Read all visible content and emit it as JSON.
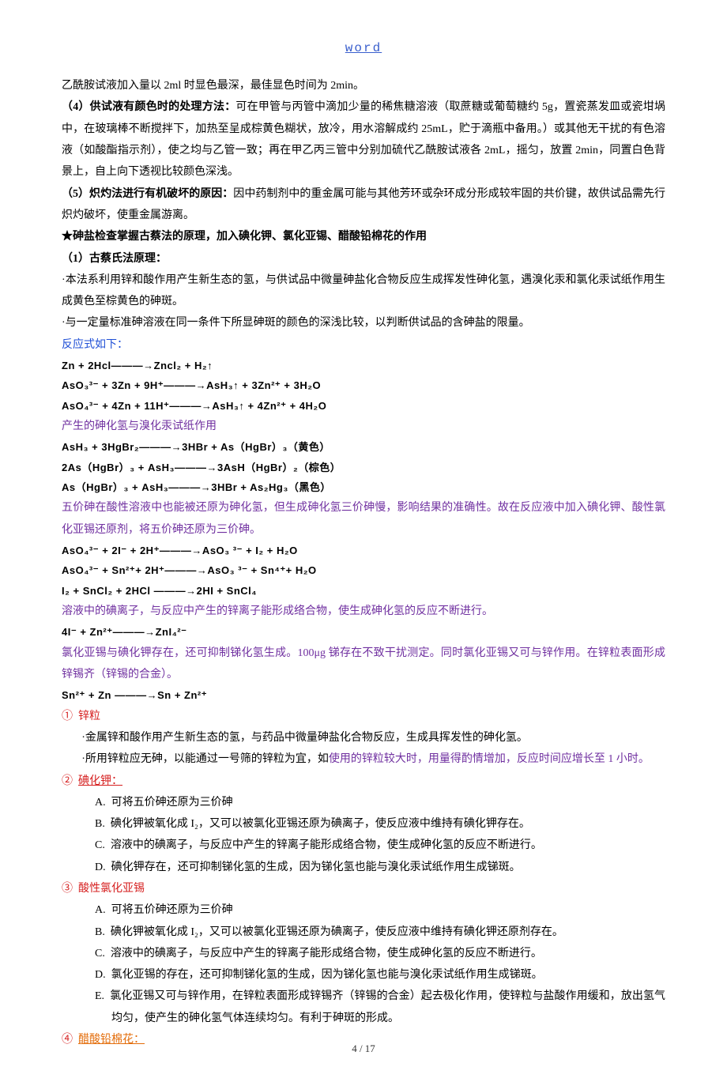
{
  "header": {
    "title": "word"
  },
  "p1": "乙酰胺试液加入量以 2ml 时显色最深，最佳显色时间为 2min。",
  "p2_label": "（4）供试液有颜色时的处理方法：",
  "p2_body": "可在甲管与丙管中滴加少量的稀焦糖溶液（取蔗糖或葡萄糖约 5g，置瓷蒸发皿或瓷坩埚中，在玻璃棒不断搅拌下，加热至呈成棕黄色糊状，放冷，用水溶解成约 25mL，贮于滴瓶中备用。）或其他无干扰的有色溶液（如酸酯指示剂），使之均与乙管一致；再在甲乙丙三管中分别加硫代乙酰胺试液各 2mL，摇匀，放置 2min，同置白色背景上，自上向下透视比较颜色深浅。",
  "p3_label": "（5）炽灼法进行有机破坏的原因：",
  "p3_body": "因中药制剂中的重金属可能与其他芳环或杂环成分形成较牢固的共价键，故供试品需先行炽灼破坏，使重金属游离。",
  "p4": "★砷盐检查掌握古蔡法的原理，加入碘化钾、氯化亚锡、醋酸铅棉花的作用",
  "p5_label": "（1）古蔡氏法原理：",
  "p5_b1": "·本法系利用锌和酸作用产生新生态的氢，与供试品中微量砷盐化合物反应生成挥发性砷化氢，遇溴化汞和氯化汞试纸作用生成黄色至棕黄色的砷斑。",
  "p5_b2": "·与一定量标准砷溶液在同一条件下所显砷斑的颜色的深浅比较，以判断供试品的含砷盐的限量。",
  "p6": "反应式如下：",
  "eq1": "Zn + 2Hcl———→Zncl₂ + H₂↑",
  "eq2": "AsO₃³⁻ + 3Zn + 9H⁺———→AsH₃↑ + 3Zn²⁺ + 3H₂O",
  "eq3": "AsO₄³⁻ + 4Zn + 11H⁺———→AsH₃↑ + 4Zn²⁺ + 4H₂O",
  "p7": "产生的砷化氢与溴化汞试纸作用",
  "eq4": "AsH₃ + 3HgBr₂———→3HBr + As（HgBr）₃（黄色）",
  "eq5": "2As（HgBr）₃ + AsH₃———→3AsH（HgBr）₂（棕色）",
  "eq6": "As（HgBr）₃ + AsH₃———→3HBr + As₂Hg₃（黑色）",
  "p8": "五价砷在酸性溶液中也能被还原为砷化氢，但生成砷化氢三价砷慢，影响结果的准确性。故在反应液中加入碘化钾、酸性氯化亚锡还原剂，将五价砷还原为三价砷。",
  "eq7": "AsO₄³⁻ + 2I⁻ + 2H⁺———→AsO₃ ³⁻ + I₂ + H₂O",
  "eq8": "AsO₄³⁻ + Sn²⁺+ 2H⁺———→AsO₃ ³⁻ + Sn⁴⁺+ H₂O",
  "eq9": "I₂ + SnCl₂ + 2HCl ———→2HI + SnCl₄",
  "p9": "溶液中的碘离子，与反应中产生的锌离子能形成络合物，使生成砷化氢的反应不断进行。",
  "eq10": "4I⁻ + Zn²⁺———→ZnI₄²⁻",
  "p10": "氯化亚锡与碘化钾存在，还可抑制锑化氢生成。100μg 锑存在不致干扰测定。同时氯化亚锡又可与锌作用。在锌粒表面形成锌锡齐（锌锡的合金）。",
  "eq11": "Sn²⁺ + Zn ———→Sn + Zn²⁺",
  "sec1": {
    "num": "①",
    "title": "锌粒"
  },
  "sec1_b1": "·金属锌和酸作用产生新生态的氢，与药品中微量砷盐化合物反应，生成具挥发性的砷化氢。",
  "sec1_b2a": "·所用锌粒应无砷，以能通过一号筛的锌粒为宜，如",
  "sec1_b2b": "使用的锌粒较大时，用量得酌情增加，反应时间应增长至 1 小时。",
  "sec2": {
    "num": "②",
    "title": "碘化钾："
  },
  "sec2_itemA": "可将五价砷还原为三价砷",
  "sec2_itemB": "碘化钾被氧化成 I₂，又可以被氯化亚锡还原为碘离子，使反应液中维持有碘化钾存在。",
  "sec2_itemC": "溶液中的碘离子，与反应中产生的锌离子能形成络合物，使生成砷化氢的反应不断进行。",
  "sec2_itemD": "碘化钾存在，还可抑制锑化氢的生成，因为锑化氢也能与溴化汞试纸作用生成锑斑。",
  "sec3": {
    "num": "③",
    "title": "酸性氯化亚锡"
  },
  "sec3_itemA": "可将五价砷还原为三价砷",
  "sec3_itemB": "碘化钾被氧化成 I₂，又可以被氯化亚锡还原为碘离子，使反应液中维持有碘化钾还原剂存在。",
  "sec3_itemC": "溶液中的碘离子，与反应中产生的锌离子能形成络合物，使生成砷化氢的反应不断进行。",
  "sec3_itemD": "氯化亚锡的存在，还可抑制锑化氢的生成，因为锑化氢也能与溴化汞试纸作用生成锑斑。",
  "sec3_itemE": "氯化亚锡又可与锌作用，在锌粒表面形成锌锡齐（锌锡的合金）起去极化作用，使锌粒与盐酸作用缓和，放出氢气均匀，使产生的砷化氢气体连续均匀。有利于砷斑的形成。",
  "sec4": {
    "num": "④",
    "title": "醋酸铅棉花："
  },
  "letters": {
    "A": "A.",
    "B": "B.",
    "C": "C.",
    "D": "D.",
    "E": "E."
  },
  "footer": "4 / 17"
}
